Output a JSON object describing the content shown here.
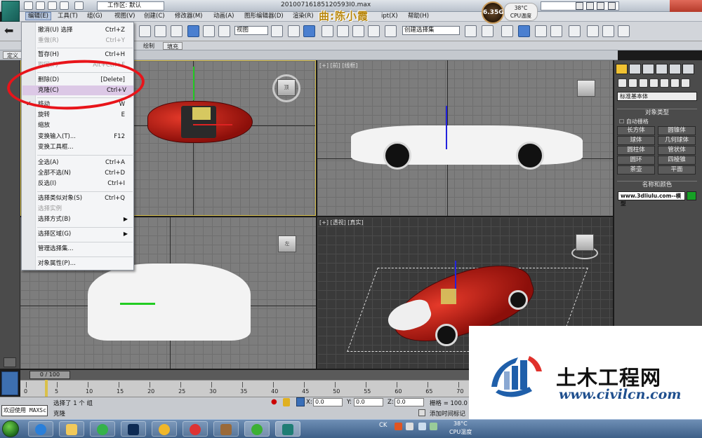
{
  "title_bar": {
    "workspace_label": "工作区: 默认",
    "file_name": "20100716185120593I0.max",
    "watermark": "曲:陈小霞"
  },
  "cpu_gauge": {
    "value": "6.35G",
    "temp": "38°C",
    "label": "CPU温度"
  },
  "menubar": {
    "items": [
      "编辑(E)",
      "工具(T)",
      "组(G)",
      "视图(V)",
      "创建(C)",
      "修改器(M)",
      "动画(A)",
      "图形编辑器(D)",
      "渲染(R)",
      "帮助(H)"
    ],
    "script_fragment": "ipt(X)"
  },
  "toolbar": {
    "view_dropdown": "视图",
    "selection_set": "创建选择集"
  },
  "ribbon": {
    "tab_fill": "填充",
    "tab_define": "定义",
    "tab_draw": "绘制"
  },
  "edit_menu": {
    "items": [
      {
        "label": "撤消(U) 选择",
        "shortcut": "Ctrl+Z",
        "disabled": false
      },
      {
        "label": "重做(R)",
        "shortcut": "Ctrl+Y",
        "disabled": true
      },
      {
        "label": "暂存(H)",
        "shortcut": "Ctrl+H",
        "disabled": false
      },
      {
        "label": "取回(F)",
        "shortcut": "Alt+Ctrl+F",
        "disabled": true
      },
      {
        "label": "删除(D)",
        "shortcut": "[Delete]",
        "disabled": false
      },
      {
        "label": "克隆(C)",
        "shortcut": "Ctrl+V",
        "disabled": false
      },
      {
        "label": "移动",
        "shortcut": "W",
        "disabled": false
      },
      {
        "label": "旋转",
        "shortcut": "E",
        "disabled": false
      },
      {
        "label": "缩放",
        "shortcut": "",
        "disabled": false
      },
      {
        "label": "变换输入(T)...",
        "shortcut": "F12",
        "disabled": false
      },
      {
        "label": "变换工具框...",
        "shortcut": "",
        "disabled": false
      },
      {
        "label": "全选(A)",
        "shortcut": "Ctrl+A",
        "disabled": false
      },
      {
        "label": "全部不选(N)",
        "shortcut": "Ctrl+D",
        "disabled": false
      },
      {
        "label": "反选(I)",
        "shortcut": "Ctrl+I",
        "disabled": false
      },
      {
        "label": "选择类似对象(S)",
        "shortcut": "Ctrl+Q",
        "disabled": false
      },
      {
        "label": "选择实例",
        "shortcut": "",
        "disabled": true
      },
      {
        "label": "选择方式(B)",
        "shortcut": "",
        "disabled": false
      },
      {
        "label": "选择区域(G)",
        "shortcut": "",
        "disabled": false
      },
      {
        "label": "管理选择集...",
        "shortcut": "",
        "disabled": false
      },
      {
        "label": "对象属性(P)...",
        "shortcut": "",
        "disabled": false
      }
    ],
    "highlighted_index": 5,
    "checked_label": "移动"
  },
  "viewports": {
    "front_label": "[+] [前] [线框]",
    "persp_label": "[+] [透视] [真实]",
    "top_cube": "顶",
    "left_cube": "左"
  },
  "command_panel": {
    "dropdown": "标准基本体",
    "object_type_header": "对象类型",
    "auto_grid": "自动栅格",
    "buttons": [
      "长方体",
      "圆锥体",
      "球体",
      "几何球体",
      "圆柱体",
      "管状体",
      "圆环",
      "四棱锥",
      "茶壶",
      "平面"
    ],
    "name_color_header": "名称和颜色",
    "name_value": "www.3dliulu.com--模型",
    "name_color": "#16a025"
  },
  "timeline": {
    "slider": "0 / 100",
    "ticks": [
      "0",
      "5",
      "10",
      "15",
      "20",
      "25",
      "30",
      "35",
      "40",
      "45",
      "50",
      "55",
      "60",
      "65",
      "70"
    ]
  },
  "status": {
    "welcome": "欢迎使用 MAXSc",
    "selected": "选择了 1 个 组",
    "action": "克隆",
    "x_label": "X:",
    "x_value": "0.0",
    "y_label": "Y:",
    "y_value": "0.0",
    "z_label": "Z:",
    "z_value": "0.0",
    "grid": "栅格 = 100.0",
    "add_tag": "添加时间标记"
  },
  "taskbar": {
    "tray_lang": "CK",
    "tray_temp": "38°C",
    "tray_cpu": "CPU温度"
  },
  "watermark_brand": {
    "title": "土木工程网",
    "url": "www.civilcn.com"
  }
}
